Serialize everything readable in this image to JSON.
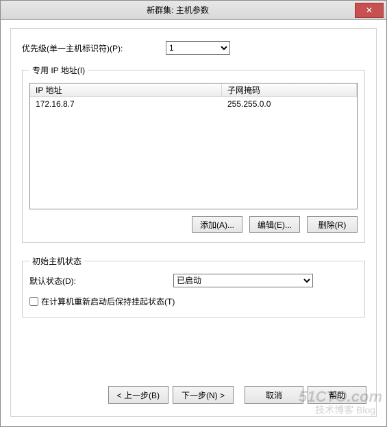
{
  "window": {
    "title": "新群集: 主机参数"
  },
  "priority": {
    "label": "优先级(单一主机标识符)(P):",
    "value": "1",
    "options": [
      "1"
    ]
  },
  "ipGroup": {
    "legend": "专用 IP 地址(I)",
    "columns": {
      "ip": "IP 地址",
      "mask": "子网掩码"
    },
    "rows": [
      {
        "ip": "172.16.8.7",
        "mask": "255.255.0.0"
      }
    ],
    "buttons": {
      "add": "添加(A)...",
      "edit": "编辑(E)...",
      "remove": "删除(R)"
    }
  },
  "initialState": {
    "legend": "初始主机状态",
    "defaultLabel": "默认状态(D):",
    "defaultValue": "已启动",
    "options": [
      "已启动"
    ],
    "keepSuspended": "在计算机重新启动后保持挂起状态(T)"
  },
  "wizard": {
    "back": "< 上一步(B)",
    "next": "下一步(N) >",
    "cancel": "取消",
    "help": "帮助"
  },
  "watermark": {
    "main": "51CTO.com",
    "sub": "技术博客 Blog"
  }
}
